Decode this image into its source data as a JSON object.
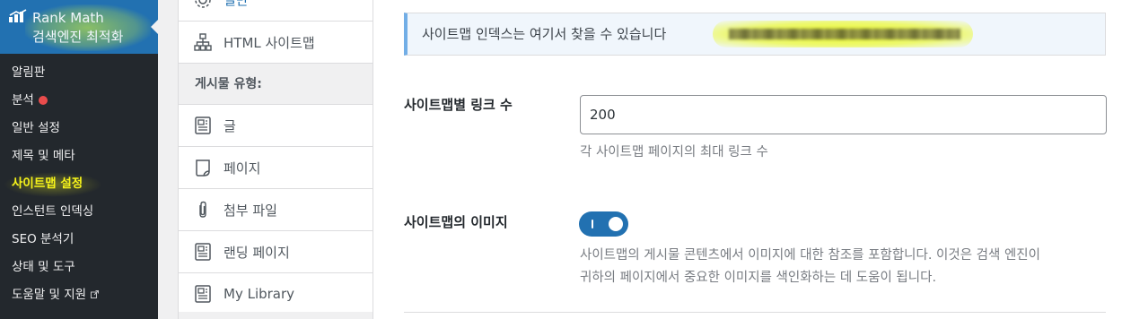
{
  "admin_menu": {
    "plugin_title": "Rank Math 검색엔진 최적화",
    "items": [
      {
        "label": "알림판",
        "badge": false,
        "external": false,
        "current": false
      },
      {
        "label": "분석",
        "badge": true,
        "external": false,
        "current": false
      },
      {
        "label": "일반 설정",
        "badge": false,
        "external": false,
        "current": false
      },
      {
        "label": "제목 및 메타",
        "badge": false,
        "external": false,
        "current": false
      },
      {
        "label": "사이트맵 설정",
        "badge": false,
        "external": false,
        "current": true
      },
      {
        "label": "인스턴트 인덱싱",
        "badge": false,
        "external": false,
        "current": false
      },
      {
        "label": "SEO 분석기",
        "badge": false,
        "external": false,
        "current": false
      },
      {
        "label": "상태 및 도구",
        "badge": false,
        "external": false,
        "current": false
      },
      {
        "label": "도움말 및 지원",
        "badge": false,
        "external": true,
        "current": false
      }
    ]
  },
  "settings_nav": {
    "top_item": "일반",
    "html_sitemap": "HTML 사이트맵",
    "section_title": "게시물 유형:",
    "post_types": [
      {
        "label": "글",
        "icon": "post-icon"
      },
      {
        "label": "페이지",
        "icon": "page-icon"
      },
      {
        "label": "첨부 파일",
        "icon": "paperclip-icon"
      },
      {
        "label": "랜딩 페이지",
        "icon": "post-icon"
      },
      {
        "label": "My Library",
        "icon": "post-icon"
      }
    ]
  },
  "main": {
    "notice_text": "사이트맵 인덱스는 여기서 찾을 수 있습니다",
    "links_per_sitemap": {
      "label": "사이트맵별 링크 수",
      "value": "200",
      "description": "각 사이트맵 페이지의 최대 링크 수"
    },
    "images_in_sitemap": {
      "label": "사이트맵의 이미지",
      "enabled": true,
      "description_line1": "사이트맵의 게시물 콘텐츠에서 이미지에 대한 참조를 포함합니다. 이것은 검색 엔진이",
      "description_line2": "귀하의 페이지에서 중요한 이미지를 색인화하는 데 도움이 됩니다."
    }
  },
  "colors": {
    "admin_bg": "#23282d",
    "accent_blue": "#2271b1",
    "current_item": "#f7f41a",
    "badge_red": "#e94c4c"
  }
}
